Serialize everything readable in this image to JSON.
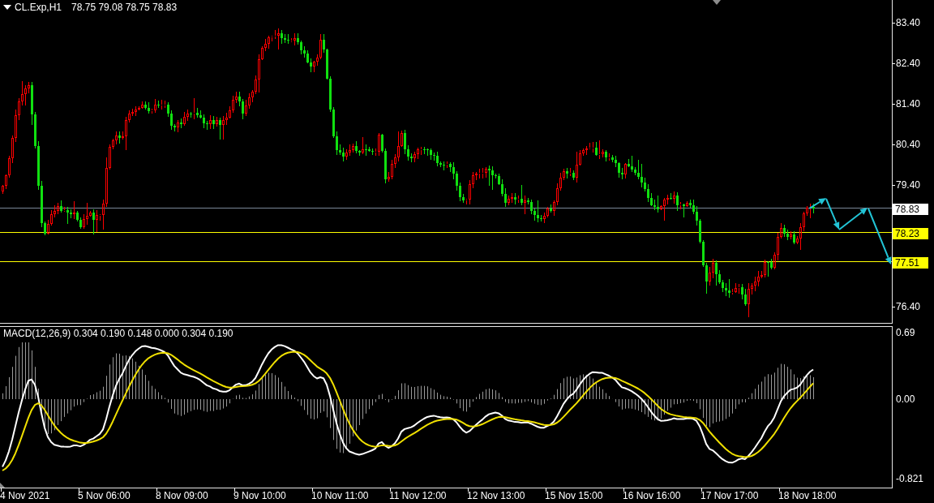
{
  "chart": {
    "symbol": "CL.Exp,H1",
    "ohlc": "78.75 79.08 78.75 78.83"
  },
  "price_axis": {
    "ticks": [
      "83.40",
      "82.40",
      "81.40",
      "80.40",
      "79.40",
      "76.40"
    ]
  },
  "price_levels": [
    {
      "kind": "bid",
      "label": "78.83",
      "color": "#ffffff"
    },
    {
      "kind": "line",
      "label": "78.23",
      "color": "#ffff00"
    },
    {
      "kind": "line",
      "label": "77.51",
      "color": "#ffff00"
    }
  ],
  "indicator": {
    "label": "MACD(12,26,9) 0.304 0.190 0.148 0.000 0.304 0.190",
    "ticks": [
      "0.69",
      "0.00",
      "-0.821"
    ]
  },
  "time_axis": {
    "labels": [
      "4 Nov 2021",
      "5 Nov 06:00",
      "8 Nov 09:00",
      "9 Nov 10:00",
      "10 Nov 11:00",
      "11 Nov 12:00",
      "12 Nov 13:00",
      "15 Nov 15:00",
      "16 Nov 16:00",
      "17 Nov 17:00",
      "18 Nov 18:00"
    ]
  }
}
